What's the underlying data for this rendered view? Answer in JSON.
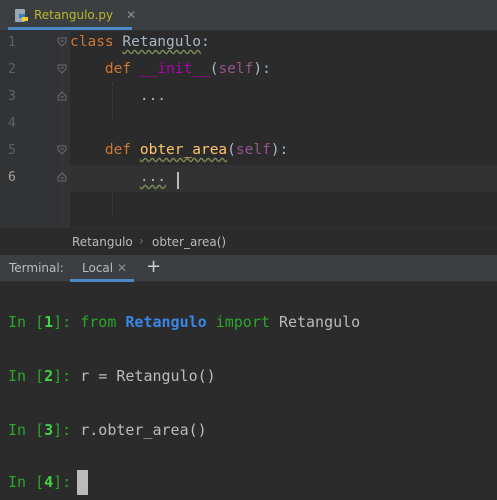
{
  "editor_tab": {
    "label": "Retangulo.py",
    "close": "✕",
    "icon": "python-file-icon"
  },
  "code": {
    "line_numbers": [
      "1",
      "2",
      "3",
      "4",
      "5",
      "6"
    ],
    "l1_kw": "class",
    "l1_name": "Retangulo",
    "l1_colon": ":",
    "l2_kw": "def",
    "l2_name": "__init__",
    "l2_open": "(",
    "l2_self": "self",
    "l2_close": "):",
    "l3_body": "...",
    "l5_kw": "def",
    "l5_name": "obter_area",
    "l5_open": "(",
    "l5_self": "self",
    "l5_close": "):",
    "l6_body": "..."
  },
  "breadcrumb": {
    "item1": "Retangulo",
    "separator": "›",
    "item2": "obter_area()"
  },
  "terminal_header": {
    "title": "Terminal:",
    "tab_label": "Local",
    "tab_close": "✕",
    "add": "+"
  },
  "terminal": {
    "prompt_in": "In [",
    "prompt_end": "]:",
    "n1": "1",
    "l1_from": "from",
    "l1_mod": "Retangulo",
    "l1_import": "import",
    "l1_name": "Retangulo",
    "n2": "2",
    "l2_code": "r = Retangulo()",
    "n3": "3",
    "l3_code": "r.obter_area()",
    "n4": "4"
  },
  "colors": {
    "background": "#2b2b2b",
    "keyword": "#cc7832",
    "function": "#ffc66d",
    "magic": "#b200b2",
    "self": "#94558d",
    "prompt": "#2aa62a",
    "module": "#3a86e6",
    "accent": "#4a88c7"
  }
}
